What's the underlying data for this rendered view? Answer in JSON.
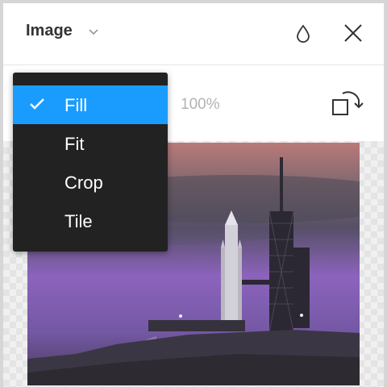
{
  "header": {
    "title": "Image",
    "chevron_icon": "chevron-down-icon",
    "blend_icon": "drop-icon",
    "close_icon": "close-icon"
  },
  "toolbar": {
    "opacity": "100%",
    "rotate_icon": "rotate-icon"
  },
  "dropdown": {
    "items": [
      {
        "label": "Fill",
        "selected": true
      },
      {
        "label": "Fit",
        "selected": false
      },
      {
        "label": "Crop",
        "selected": false
      },
      {
        "label": "Tile",
        "selected": false
      }
    ],
    "selected_color": "#1a9cff",
    "background_color": "#222222"
  },
  "preview": {
    "description_icon": "image-preview"
  }
}
